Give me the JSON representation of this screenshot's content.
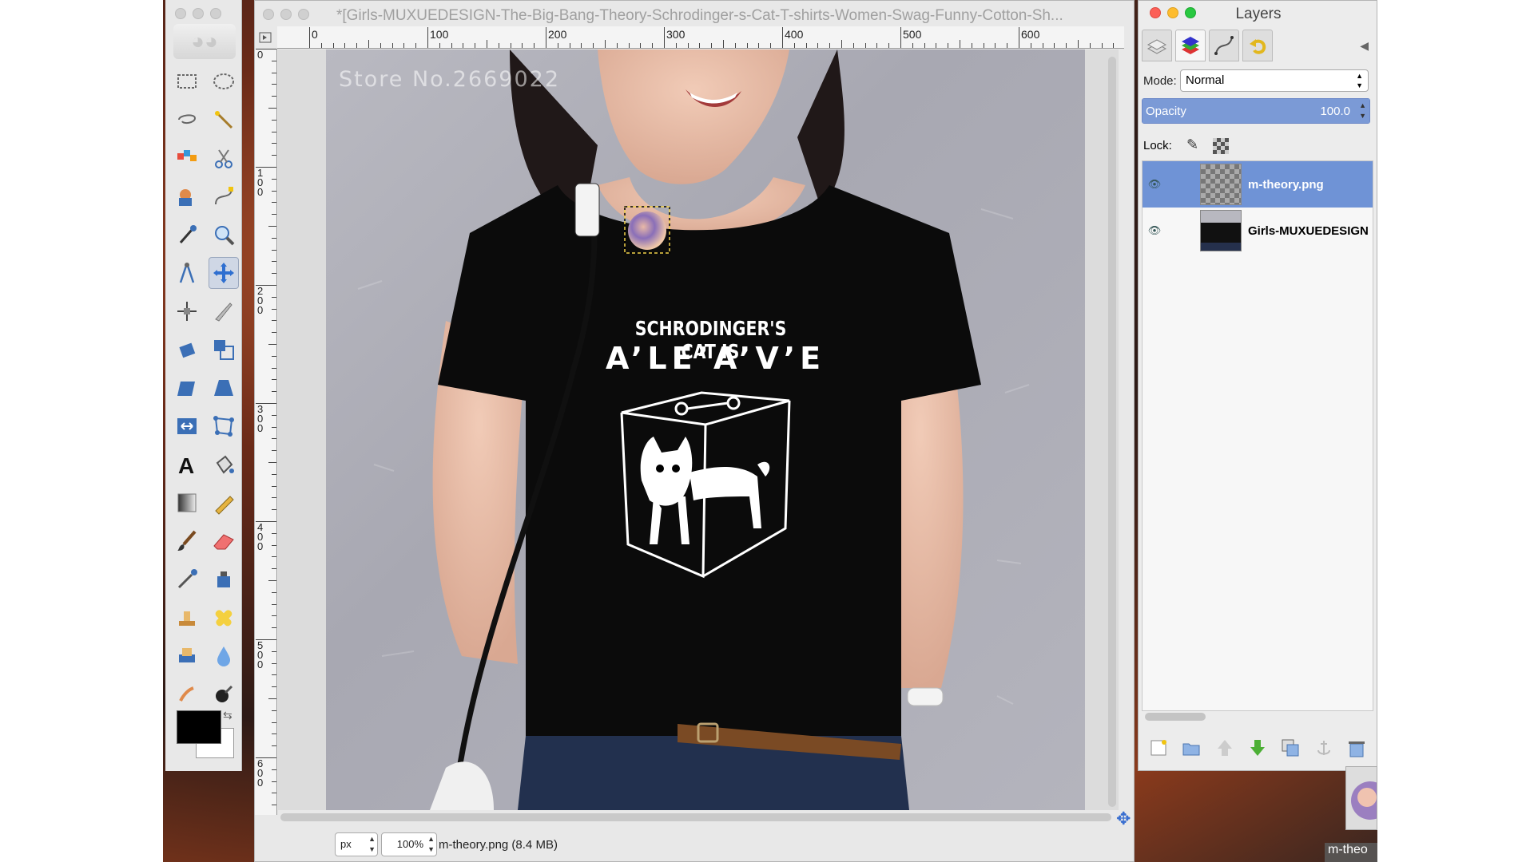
{
  "image_window": {
    "title": "*[Girls-MUXUEDESIGN-The-Big-Bang-Theory-Schrodinger-s-Cat-T-shirts-Women-Swag-Funny-Cotton-Sh...",
    "ruler_h": [
      "0",
      "100",
      "200",
      "300",
      "400",
      "500",
      "600"
    ],
    "ruler_v": [
      "0",
      "1\n0\n0",
      "2\n0\n0",
      "3\n0\n0",
      "4\n0\n0",
      "5\n0\n0",
      "6\n0\n0"
    ],
    "watermark": "Store No.2669022",
    "shirt_line1": "SCHRODINGER'S CAT IS",
    "shirt_line2": "A’LE’A’V’E",
    "status": {
      "unit": "px",
      "zoom": "100%",
      "info": "m-theory.png (8.4 MB)"
    }
  },
  "layers_window": {
    "title": "Layers",
    "mode_label": "Mode:",
    "mode_value": "Normal",
    "opacity_label": "Opacity",
    "opacity_value": "100.0",
    "opacity_fraction": 1.0,
    "lock_label": "Lock:",
    "layers": [
      {
        "name": "m-theory.png",
        "selected": true,
        "visible": true
      },
      {
        "name": "Girls-MUXUEDESIGN-",
        "selected": false,
        "visible": true
      }
    ]
  },
  "preview_label": "m-theo",
  "colors": {
    "selection": "#6f93d6",
    "foreground": "#000000",
    "background": "#ffffff"
  }
}
